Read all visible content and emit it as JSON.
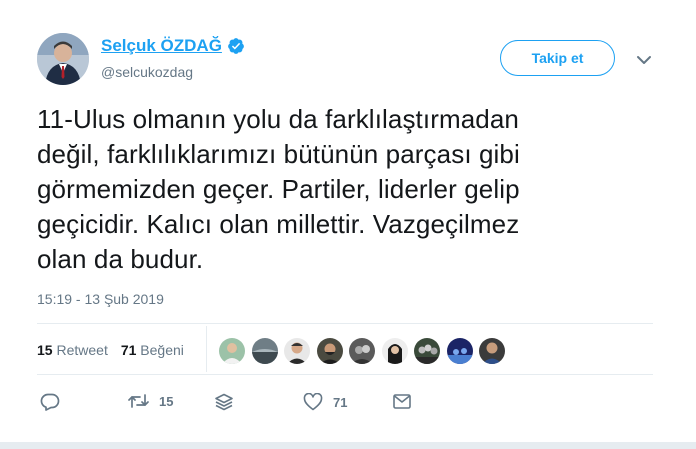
{
  "author": {
    "display_name": "Selçuk ÖZDAĞ",
    "handle": "@selcukozdag",
    "verified": true
  },
  "follow_button": {
    "label": "Takip et"
  },
  "tweet": {
    "text": "11-Ulus olmanın yolu da farklılaştırmadan\ndeğil, farklılıklarımızı bütünün parçası gibi\ngörmemizden geçer. Partiler, liderler gelip\ngeçicidir. Kalıcı olan millettir. Vazgeçilmez\nolan da budur.",
    "timestamp": "15:19 - 13 Şub 2019"
  },
  "stats": {
    "retweet_count": "15",
    "retweet_label": "Retweet",
    "like_count": "71",
    "like_label": "Beğeni"
  },
  "actions": {
    "retweet_count": "15",
    "like_count": "71"
  },
  "colors": {
    "accent": "#1da1f2",
    "text": "#14171a",
    "muted": "#657786",
    "divider": "#e6ecf0"
  }
}
